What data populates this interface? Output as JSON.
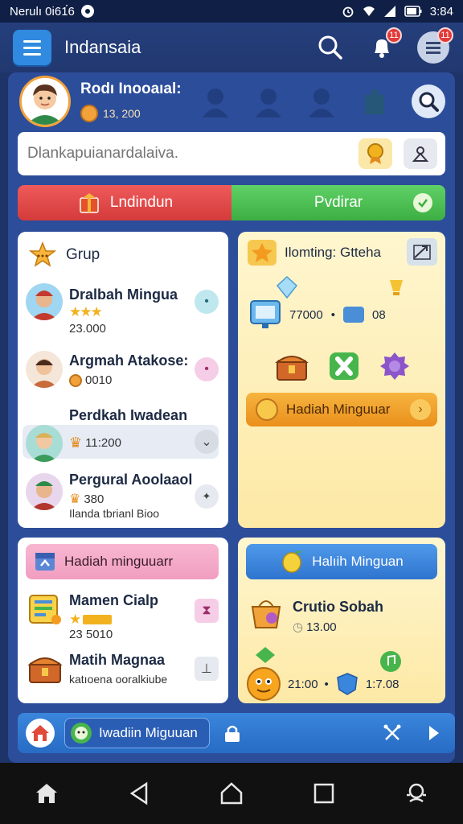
{
  "status_bar": {
    "left_text": "Nerulı 0i61́6",
    "time": "3:84"
  },
  "app_bar": {
    "title": "Indansaia",
    "notif_badge": "11",
    "menu_badge": "11"
  },
  "profile": {
    "name": "Rodı Inooaıal:",
    "coins": "13, 200"
  },
  "search": {
    "placeholder": "Dlankapuianardalaiva."
  },
  "tabs": [
    {
      "label": "Lndindun"
    },
    {
      "label": "Pvdirar"
    }
  ],
  "group": {
    "title": "Grup",
    "members": [
      {
        "name": "Dralbah Mingua",
        "sub": "23.000"
      },
      {
        "name": "Argmah Atakose:",
        "sub": "0010"
      },
      {
        "name": "Perdkah Iwadean",
        "sub": "11:200"
      },
      {
        "name": "Pergural Aoolaaol",
        "sub": "380",
        "note": "Ilanda tbrianl Bioo"
      }
    ]
  },
  "events": {
    "title": "Ilomting: Gtteha",
    "stat_time": "77000",
    "stat_count": "08",
    "reward_label": "Hadiah Minguuar"
  },
  "weekly": {
    "title": "Hadiah minguuarr",
    "items": [
      {
        "name": "Mamen Cialp",
        "sub": "23 5010"
      },
      {
        "name": "Matih Magnaa",
        "sub": "katıoena ooralkiube"
      }
    ]
  },
  "special": {
    "title": "Halıih Minguan",
    "item_name": "Crutio Sobah",
    "item_value": "13.00",
    "time_a": "21:00",
    "time_b": "1:7.08"
  },
  "bottom_bar": {
    "pill_label": "Iwadiin Miguuan"
  },
  "colors": {
    "accent_blue": "#2f8ae0",
    "panel": "#2c4d9a",
    "tab_red": "#d43b3b",
    "tab_green": "#3cae42"
  }
}
